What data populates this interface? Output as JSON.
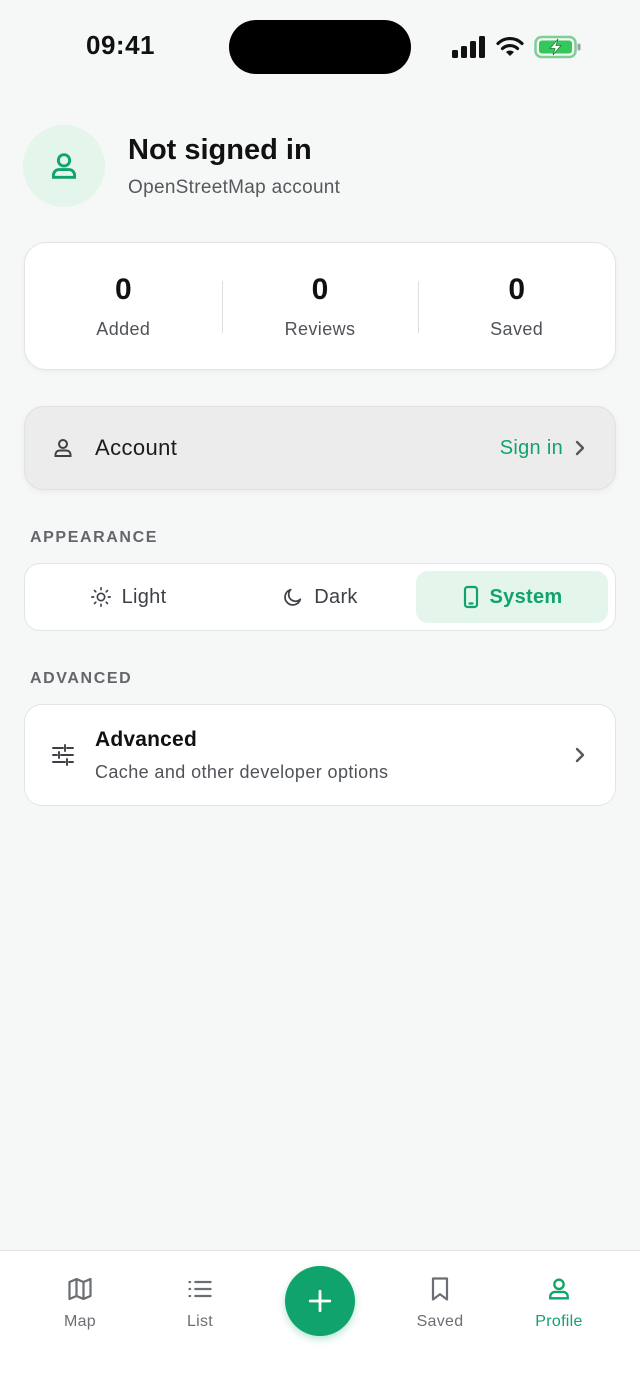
{
  "status_bar": {
    "time": "09:41",
    "icons": [
      "cellular-signal-icon",
      "wifi-icon",
      "battery-charging-icon"
    ]
  },
  "profile": {
    "name": "Not signed in",
    "subtitle": "OpenStreetMap account",
    "avatar_icon": "person-icon"
  },
  "stats": [
    {
      "value": "0",
      "label": "Added"
    },
    {
      "value": "0",
      "label": "Reviews"
    },
    {
      "value": "0",
      "label": "Saved"
    }
  ],
  "account": {
    "label": "Account",
    "action": "Sign in",
    "icon": "person-icon"
  },
  "appearance": {
    "header": "APPEARANCE",
    "options": [
      {
        "label": "Light",
        "icon": "sun-icon"
      },
      {
        "label": "Dark",
        "icon": "moon-icon"
      },
      {
        "label": "System",
        "icon": "phone-icon"
      }
    ],
    "selected": "System"
  },
  "advanced": {
    "header": "ADVANCED",
    "title": "Advanced",
    "subtitle": "Cache and other developer options",
    "icon": "sliders-icon"
  },
  "bottom_nav": {
    "items": [
      {
        "label": "Map",
        "icon": "map-icon"
      },
      {
        "label": "List",
        "icon": "list-icon"
      },
      {
        "label": "Saved",
        "icon": "bookmark-icon"
      },
      {
        "label": "Profile",
        "icon": "person-icon"
      }
    ],
    "active": "Profile",
    "fab_icon": "plus-icon"
  },
  "colors": {
    "accent": "#10a36b",
    "accent_soft": "#e4f5ec",
    "background": "#f6f7f7",
    "battery": "#34c759"
  }
}
